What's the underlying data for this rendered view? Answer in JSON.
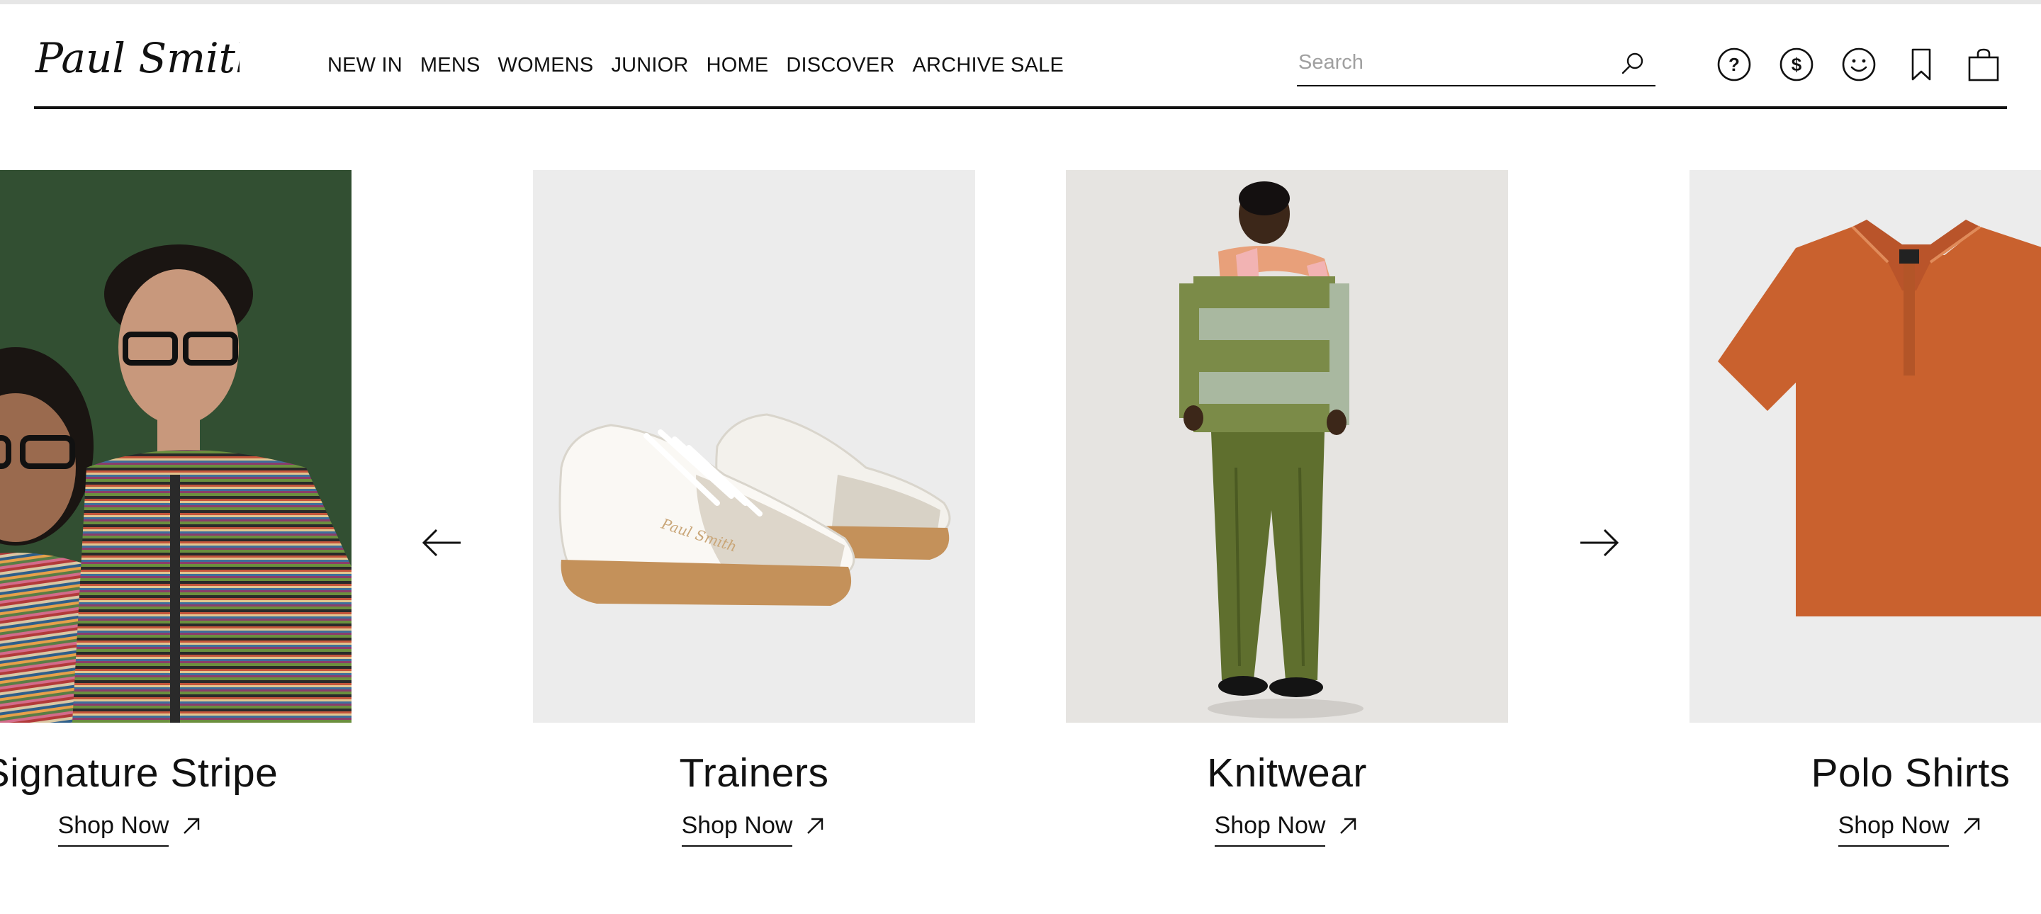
{
  "brand": {
    "logo_text": "Paul Smith"
  },
  "nav": {
    "items": [
      {
        "label": "NEW IN"
      },
      {
        "label": "MENS"
      },
      {
        "label": "WOMENS"
      },
      {
        "label": "JUNIOR"
      },
      {
        "label": "HOME"
      },
      {
        "label": "DISCOVER"
      },
      {
        "label": "ARCHIVE SALE"
      }
    ]
  },
  "search": {
    "placeholder": "Search",
    "value": ""
  },
  "utility_icons": [
    "help-icon",
    "currency-icon",
    "account-icon",
    "wishlist-icon",
    "bag-icon"
  ],
  "carousel": {
    "prev_icon": "arrow-left-icon",
    "next_icon": "arrow-right-icon",
    "cards": [
      {
        "title": "Signature Stripe",
        "cta": "Shop Now"
      },
      {
        "title": "Trainers",
        "cta": "Shop Now"
      },
      {
        "title": "Knitwear",
        "cta": "Shop Now"
      },
      {
        "title": "Polo Shirts",
        "cta": "Shop Now"
      }
    ]
  },
  "colors": {
    "text": "#111111",
    "placeholder": "#a0a0a0",
    "stripe_bg": "#2e4a2f",
    "product_bg": "#ececec",
    "polo": "#c9612e",
    "knit_green": "#6d7f3d"
  }
}
